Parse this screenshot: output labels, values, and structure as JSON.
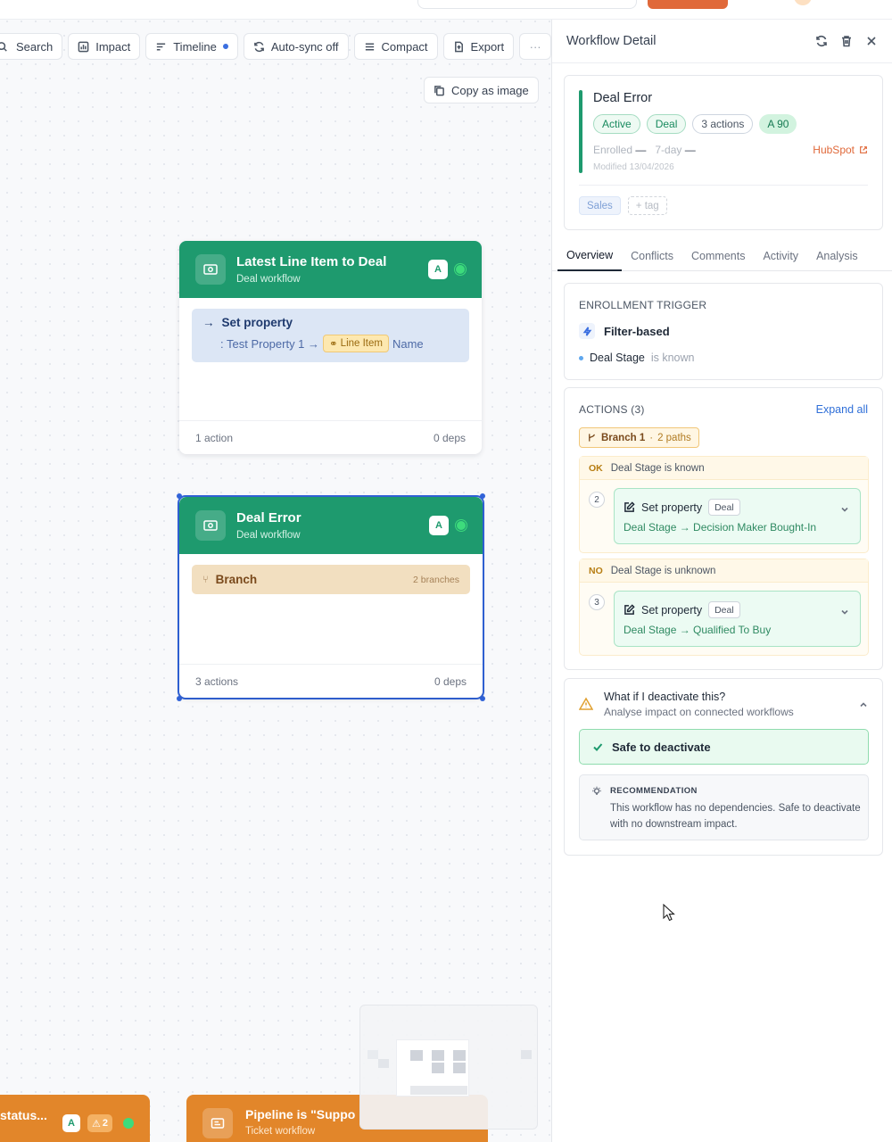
{
  "toolbar": {
    "search": "Search",
    "impact": "Impact",
    "timeline": "Timeline",
    "autosync": "Auto-sync off",
    "compact": "Compact",
    "export": "Export",
    "more": "···",
    "copy_image": "Copy as image"
  },
  "nodes": {
    "latest": {
      "title": "Latest Line Item to Deal",
      "subtitle": "Deal workflow",
      "badge": "A",
      "step_title": "Set property",
      "step_prefix": ": Test Property 1 →",
      "step_chip": "Line Item",
      "step_suffix": "Name",
      "actions": "1 action",
      "deps": "0 deps"
    },
    "deal_error": {
      "title": "Deal Error",
      "subtitle": "Deal workflow",
      "badge": "A",
      "branch_title": "Branch",
      "branch_count": "2 branches",
      "actions": "3 actions",
      "deps": "0 deps"
    },
    "bottom_left": {
      "title": "status...",
      "badge": "A",
      "warn": "2"
    },
    "bottom_mid": {
      "title": "Pipeline is \"Suppo",
      "subtitle": "Ticket workflow"
    }
  },
  "panel": {
    "title": "Workflow Detail",
    "summary": {
      "name": "Deal Error",
      "tags": [
        "Active",
        "Deal",
        "3 actions",
        "A 90"
      ],
      "enrolled_label": "Enrolled",
      "enrolled_value": "—",
      "period_label": "7-day",
      "period_value": "—",
      "modified": "Modified 13/04/2026",
      "hubspot": "HubSpot",
      "label_tag": "Sales",
      "add_tag": "+ tag"
    },
    "tabs": [
      "Overview",
      "Conflicts",
      "Comments",
      "Activity",
      "Analysis"
    ],
    "active_tab": "Overview",
    "trigger": {
      "label": "ENROLLMENT TRIGGER",
      "type": "Filter-based",
      "condition_field": "Deal Stage",
      "condition_op": "is known"
    },
    "actions": {
      "label": "ACTIONS (3)",
      "expand": "Expand all",
      "branch_name": "Branch 1",
      "branch_paths": "2 paths",
      "paths": [
        {
          "tag": "OK",
          "condition": "Deal Stage is known",
          "step_num": "2",
          "step_title": "Set property",
          "step_chip": "Deal",
          "step_desc": "Deal Stage → Decision Maker Bought-In"
        },
        {
          "tag": "NO",
          "condition": "Deal Stage is unknown",
          "step_num": "3",
          "step_title": "Set property",
          "step_chip": "Deal",
          "step_desc": "Deal Stage → Qualified To Buy"
        }
      ]
    },
    "impact": {
      "question": "What if I deactivate this?",
      "sub": "Analyse impact on connected workflows",
      "safe": "Safe to deactivate",
      "reco_label": "RECOMMENDATION",
      "reco_text": "This workflow has no dependencies. Safe to deactivate with no downstream impact."
    }
  }
}
